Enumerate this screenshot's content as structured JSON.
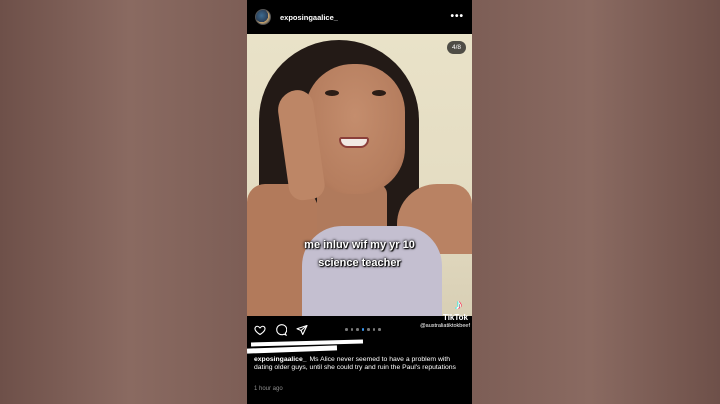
{
  "post": {
    "username": "exposingaalice_",
    "more_icon": "more-horizontal-icon",
    "more_glyph": "•••",
    "carousel_count": "4/8",
    "overlay_text_line1": "me inluv wif my yr 10",
    "overlay_text_line2": "science teacher",
    "caption_username": "exposingaalice_",
    "caption_text": "Ms Alice never seemed to have a problem with dating older guys, until she could try and ruin the Paul's reputations",
    "timestamp": "1 hour ago",
    "carousel_dots": 7,
    "active_dot_index": 3
  },
  "actions": {
    "like_icon": "heart-icon",
    "comment_icon": "comment-icon",
    "share_icon": "send-icon"
  },
  "watermark": {
    "logo_icon": "tiktok-logo-icon",
    "logo_glyph": "♪",
    "brand": "TikTok",
    "handle": "@australiatiktokbeef"
  },
  "colors": {
    "background": "#000000",
    "text": "#ffffff",
    "muted": "#8e8e8e",
    "active_dot": "#3897f0"
  }
}
